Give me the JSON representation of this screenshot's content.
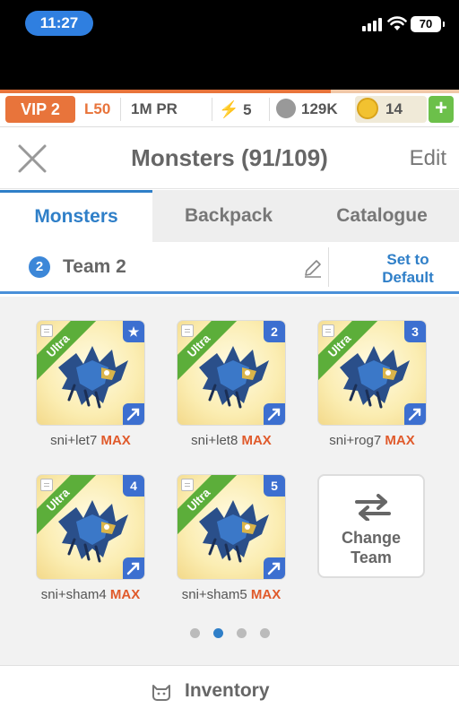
{
  "status": {
    "time": "11:27",
    "battery": "70"
  },
  "resources": {
    "vip": "VIP 2",
    "level": "L50",
    "pr": "1M PR",
    "energy": "5",
    "food": "129K",
    "gold": "14",
    "xp_progress_percent": 72
  },
  "header": {
    "title": "Monsters (91/109)",
    "edit_label": "Edit"
  },
  "tabs": [
    {
      "label": "Monsters",
      "active": true
    },
    {
      "label": "Backpack",
      "active": false
    },
    {
      "label": "Catalogue",
      "active": false
    }
  ],
  "team": {
    "number": "2",
    "name": "Team 2",
    "set_default_line1": "Set to",
    "set_default_line2": "Default"
  },
  "monsters": [
    {
      "name": "sni+let7",
      "level": "MAX",
      "rarity": "Ultra",
      "badge": "★"
    },
    {
      "name": "sni+let8",
      "level": "MAX",
      "rarity": "Ultra",
      "badge": "2"
    },
    {
      "name": "sni+rog7",
      "level": "MAX",
      "rarity": "Ultra",
      "badge": "3"
    },
    {
      "name": "sni+sham4",
      "level": "MAX",
      "rarity": "Ultra",
      "badge": "4"
    },
    {
      "name": "sni+sham5",
      "level": "MAX",
      "rarity": "Ultra",
      "badge": "5"
    }
  ],
  "change_team": {
    "line1": "Change",
    "line2": "Team"
  },
  "pagination": {
    "pages": 4,
    "current": 2
  },
  "bottom": {
    "inventory_label": "Inventory"
  },
  "colors": {
    "accent_blue": "#2f7fc8",
    "vip_orange": "#e8743b",
    "max_red": "#e05a2b",
    "ultra_green": "#5cae3a"
  }
}
